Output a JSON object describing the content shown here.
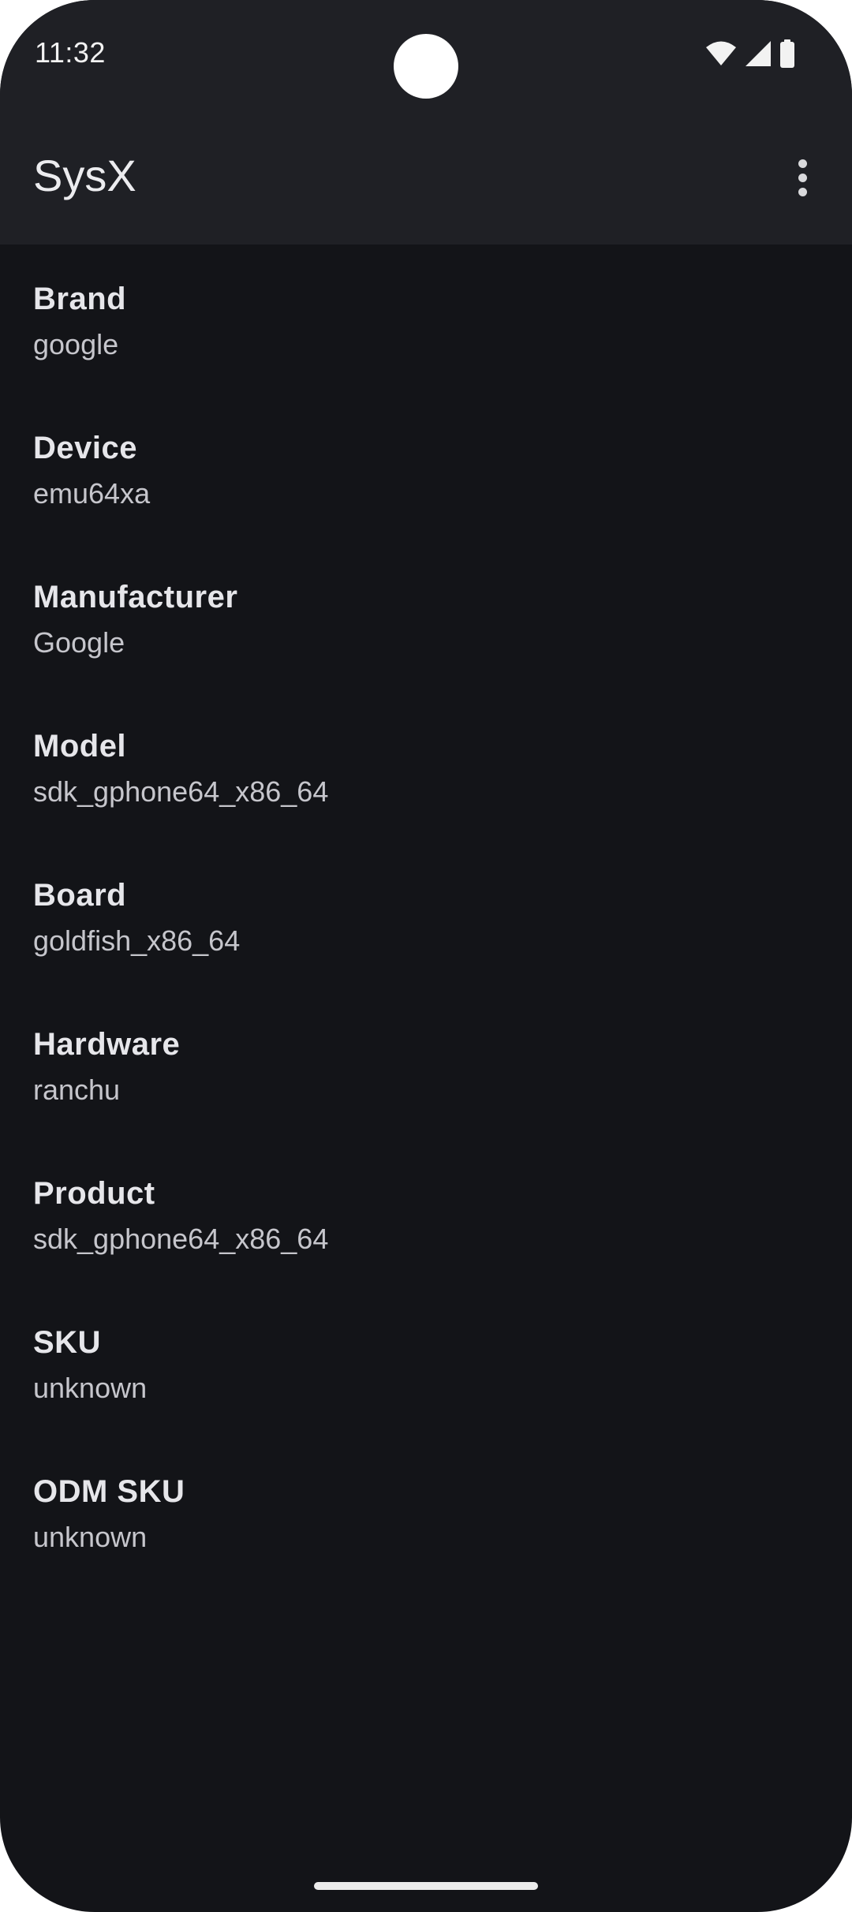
{
  "status_bar": {
    "time": "11:32",
    "icons": [
      "wifi-icon",
      "cellular-signal-icon",
      "battery-icon"
    ]
  },
  "app_bar": {
    "title": "SysX",
    "overflow_icon": "more-vert-icon"
  },
  "items": [
    {
      "label": "Brand",
      "value": "google"
    },
    {
      "label": "Device",
      "value": "emu64xa"
    },
    {
      "label": "Manufacturer",
      "value": "Google"
    },
    {
      "label": "Model",
      "value": "sdk_gphone64_x86_64"
    },
    {
      "label": "Board",
      "value": "goldfish_x86_64"
    },
    {
      "label": "Hardware",
      "value": "ranchu"
    },
    {
      "label": "Product",
      "value": "sdk_gphone64_x86_64"
    },
    {
      "label": "SKU",
      "value": "unknown"
    },
    {
      "label": "ODM SKU",
      "value": "unknown"
    }
  ],
  "colors": {
    "background": "#131418",
    "app_bar": "#1f2025",
    "label": "#e6e6ea",
    "value": "#c6c6cc"
  }
}
